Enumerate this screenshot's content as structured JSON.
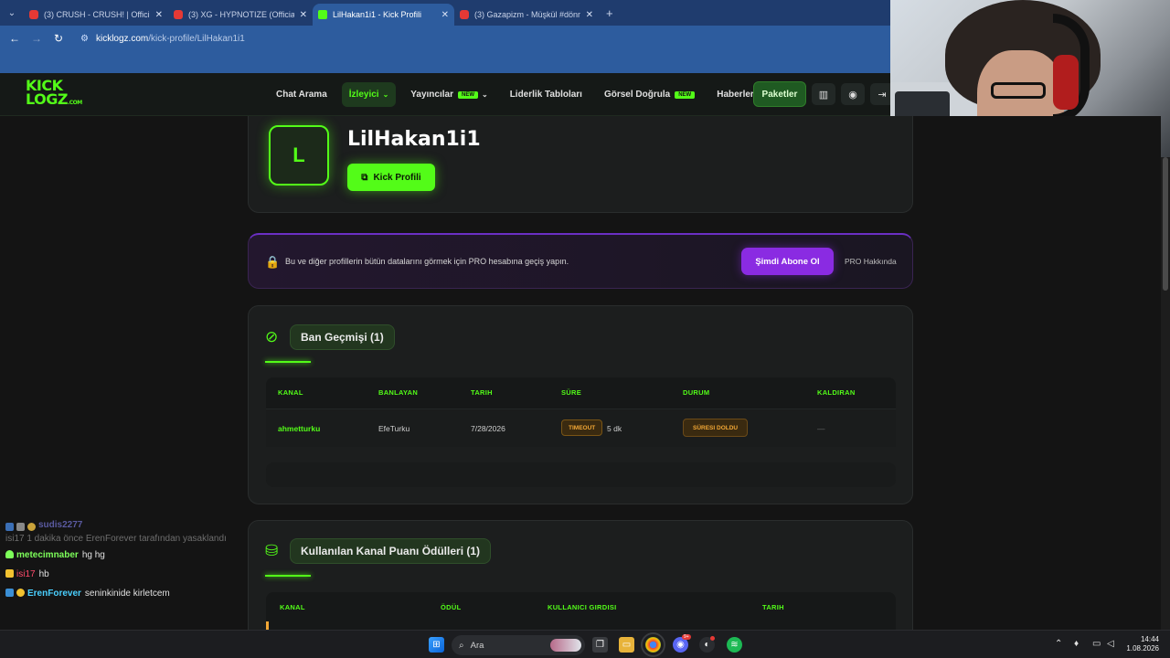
{
  "browser": {
    "tabs": [
      {
        "title": "(3) CRUSH - CRUSH! | Official M",
        "type": "youtube"
      },
      {
        "title": "(3) XG - HYPNOTIZE (Official M",
        "type": "youtube"
      },
      {
        "title": "LilHakan1i1 - Kick Profili",
        "type": "kick"
      },
      {
        "title": "(3) Gazapizm - Müşkül #dönme",
        "type": "youtube"
      }
    ],
    "url_domain": "kicklogz.com",
    "url_path": "/kick-profile/LilHakan1i1"
  },
  "site": {
    "logo_line1": "KICK",
    "logo_line2": "LOGZ",
    "logo_suffix": ".COM",
    "nav": {
      "chat_arama": "Chat Arama",
      "izleyici": "İzleyici",
      "yayincilar": "Yayıncılar",
      "new_badge": "NEW",
      "liderlik": "Liderlik Tabloları",
      "gorsel": "Görsel Doğrula",
      "haberler": "Haberler",
      "paketler": "Paketler"
    }
  },
  "profile": {
    "avatar_letter": "L",
    "name": "LilHakan1i1",
    "kick_button": "Kick Profili"
  },
  "pro_banner": {
    "text": "Bu ve diğer profillerin bütün datalarını görmek için PRO hesabına geçiş yapın.",
    "subscribe": "Şimdi Abone Ol",
    "about": "PRO Hakkında"
  },
  "ban_history": {
    "title": "Ban Geçmişi (1)",
    "headers": {
      "kanal": "KANAL",
      "banlayan": "BANLAYAN",
      "tarih": "TARIH",
      "sure": "SÜRE",
      "durum": "DURUM",
      "kaldiran": "KALDIRAN"
    },
    "rows": [
      {
        "kanal": "ahmetturku",
        "banlayan": "EfeTurku",
        "tarih": "7/28/2026",
        "type": "TIMEOUT",
        "sure": "5 dk",
        "durum": "SÜRESI DOLDU",
        "kaldiran": "—"
      }
    ]
  },
  "rewards": {
    "title": "Kullanılan Kanal Puanı Ödülleri (1)",
    "headers": {
      "kanal": "KANAL",
      "odul": "ÖDÜL",
      "girdi": "KULLANICI GIRDISI",
      "tarih": "TARIH"
    }
  },
  "chat": [
    {
      "user": "sudis2277",
      "text": "isi17 1 dakika önce ErenForever tarafından yasaklandı",
      "color": "#5a5aa0"
    },
    {
      "user": "metecimnaber",
      "text": "hg hg",
      "color": "#7dff5a"
    },
    {
      "user": "isi17",
      "text": "hb",
      "color": "#ff4a6a"
    },
    {
      "user": "ErenForever",
      "text": "seninkinide kirletcem",
      "color": "#4ad0ff"
    }
  ],
  "taskbar": {
    "search_placeholder": "Ara",
    "time": "14:44",
    "date": "1.08.2026",
    "discord_badge": "9+"
  }
}
